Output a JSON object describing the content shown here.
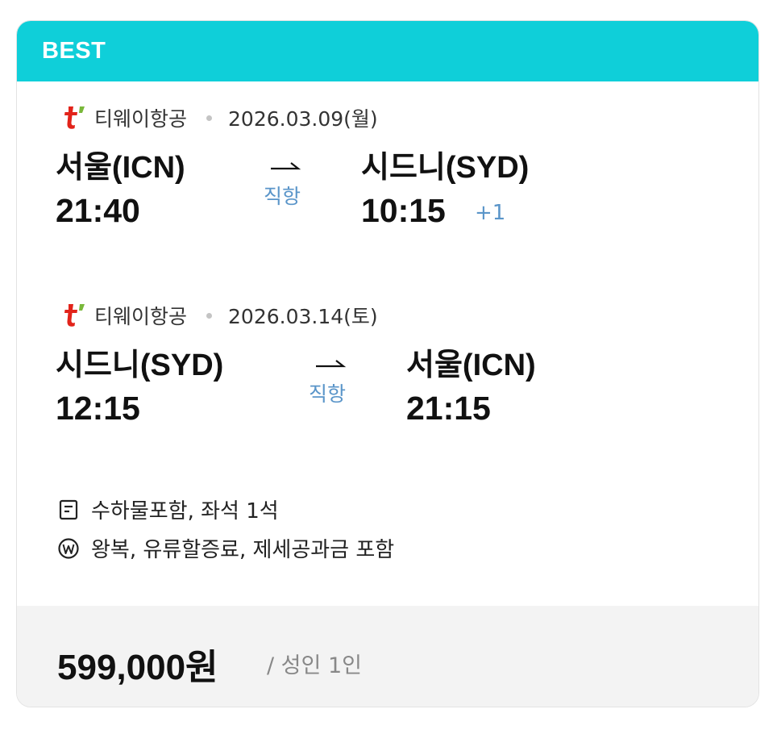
{
  "badge": {
    "label": "BEST"
  },
  "colors": {
    "accent": "#0fcfd9",
    "direct_text": "#5a95c9",
    "price_bg": "#f3f3f3"
  },
  "outbound": {
    "airline": "티웨이항공",
    "airline_icon": "tway-logo-icon",
    "date": "2026.03.09(월)",
    "from_city": "서울(ICN)",
    "depart_time": "21:40",
    "flight_type": "직항",
    "to_city": "시드니(SYD)",
    "arrive_time": "10:15",
    "day_offset": "+1"
  },
  "inbound": {
    "airline": "티웨이항공",
    "airline_icon": "tway-logo-icon",
    "date": "2026.03.14(토)",
    "from_city": "시드니(SYD)",
    "depart_time": "12:15",
    "flight_type": "직항",
    "to_city": "서울(ICN)",
    "arrive_time": "21:15"
  },
  "info": {
    "baggage": {
      "icon": "baggage-doc-icon",
      "text": "수하물포함, 좌석 1석"
    },
    "fare": {
      "icon": "won-circle-icon",
      "text": "왕복, 유류할증료, 제세공과금 포함"
    }
  },
  "price": {
    "amount": "599,000원",
    "per_label": "/ 성인 1인"
  }
}
